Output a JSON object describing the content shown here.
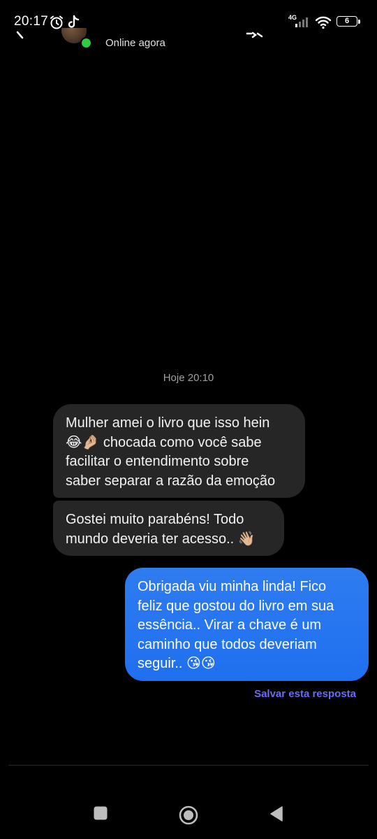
{
  "status_bar": {
    "time": "20:17",
    "network": "4G",
    "battery": "6",
    "icons": [
      "alarm-icon",
      "tiktok-icon",
      "signal-icon",
      "wifi-icon",
      "battery-icon"
    ]
  },
  "header": {
    "status": "Online agora",
    "icons": [
      "back-icon",
      "avatar",
      "video-icon"
    ]
  },
  "conversation": {
    "timestamp": "Hoje 20:10",
    "messages": [
      {
        "direction": "incoming",
        "text": "Mulher amei o livro que isso hein\n😂🤌🏼 chocada como você sabe\nfacilitar o entendimento sobre\nsaber separar a razão da emoção"
      },
      {
        "direction": "incoming",
        "text": "Gostei muito parabéns! Todo\nmundo deveria ter acesso.. 👋🏼"
      },
      {
        "direction": "outgoing",
        "text": "Obrigada viu minha linda! Fico\nfeliz que gostou do livro em sua\nessência.. Virar a chave é um\ncaminho que todos deveriam\nseguir.. 😘😘"
      }
    ],
    "save_reply_label": "Salvar esta resposta"
  },
  "colors": {
    "background": "#000000",
    "incoming_bubble": "#262626",
    "outgoing_bubble": "#2677F0",
    "save_reply": "#6A6CF4",
    "online": "#2ECC40"
  },
  "nav": {
    "icons": [
      "recent-apps-icon",
      "home-icon",
      "back-nav-icon"
    ]
  }
}
